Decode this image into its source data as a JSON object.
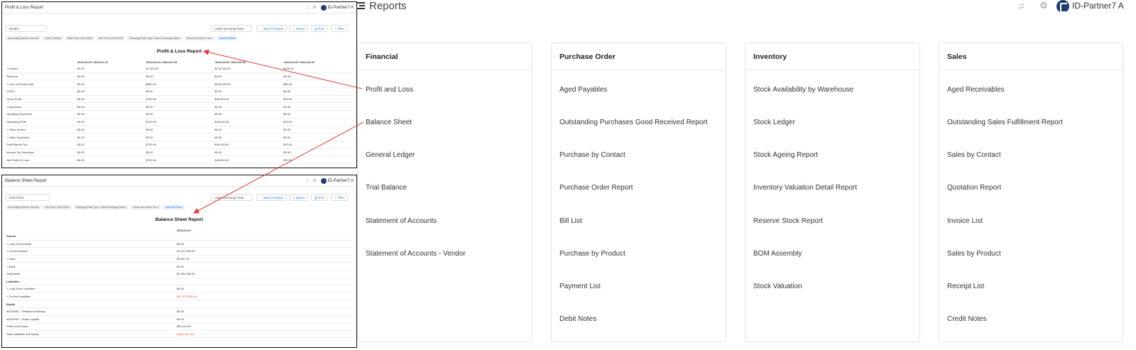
{
  "header": {
    "title": "Reports",
    "user": "ID-Partner7 A",
    "icons": [
      "hamburger-icon",
      "bell-icon",
      "gear-icon",
      "avatar"
    ]
  },
  "categories": [
    {
      "title": "Financial",
      "items": [
        "Profit and Loss",
        "Balance Sheet",
        "General Ledger",
        "Trial Balance",
        "Statement of Accounts",
        "Statement of Accounts - Vendor"
      ]
    },
    {
      "title": "Purchase Order",
      "items": [
        "Aged Payables",
        "Outstanding Purchases Good Received Report",
        "Purchase by Contact",
        "Purchase Order Report",
        "Bill List",
        "Purchase by Product",
        "Payment List",
        "Debit Notes"
      ]
    },
    {
      "title": "Inventory",
      "items": [
        "Stock Availability by Warehouse",
        "Stock Ledger",
        "Stock Ageing Report",
        "Inventory Valuation Detail Report",
        "Reserve Stock Report",
        "BOM Assembly",
        "Stock Valuation"
      ]
    },
    {
      "title": "Sales",
      "items": [
        "Aged Receivables",
        "Outstanding Sales Fulfillment Report",
        "Sales by Contact",
        "Quotation Report",
        "Invoice List",
        "Sales by Product",
        "Receipt List",
        "Credit Notes"
      ]
    }
  ],
  "pl": {
    "window_title": "Profit & Loss Report",
    "user": "ID-Partner7 A",
    "period_select": "Months",
    "rate_select": "Latest Exchange Rate",
    "buttons": {
      "back": "← Back to Report",
      "export": "⇩ Export",
      "print": "⎙ Print",
      "filter": "⊤ Filter"
    },
    "chips": [
      "Accounting Method: Accrual",
      "Cycle: Months",
      "Start Time: 01/01/2024",
      "End Time: 04/07/2024",
      "Exchange Rate Type: Latest Exchange Rate ×",
      "Show zero items: Yes ×"
    ],
    "clear": "Clear All Filters",
    "report_title": "Profit & Loss Report",
    "columns": [
      "2024-01-01~2024-01-31",
      "2024-02-01~2024-02-29",
      "2024-03-01~2024-03-31",
      "2024-04-01~2024-04-07"
    ],
    "rows": [
      {
        "label": "+ Income",
        "v": [
          "$0.00",
          "$1,300.00",
          "$176,000.00",
          "$150.00"
        ]
      },
      {
        "label": "Revenue",
        "v": [
          "$0.00",
          "$0.00",
          "$0.00",
          "$0.00"
        ]
      },
      {
        "label": "+ Cost of Goods Sold",
        "v": [
          "$0.00",
          "$600.00",
          "$130,000.00",
          "$80.00"
        ]
      },
      {
        "label": "COGS",
        "v": [
          "$0.00",
          "$0.00",
          "$0.00",
          "$0.00"
        ]
      },
      {
        "label": "Gross Profit",
        "v": [
          "$0.00",
          "$700.00",
          "$46,000.00",
          "$70.00"
        ]
      },
      {
        "label": "+ Expenses",
        "v": [
          "$0.00",
          "$0.00",
          "$0.00",
          "$0.00"
        ]
      },
      {
        "label": "Operating Expenses",
        "v": [
          "$0.00",
          "$0.00",
          "$0.00",
          "$0.00"
        ]
      },
      {
        "label": "Operating Profit",
        "v": [
          "$0.00",
          "$700.00",
          "$46,000.00",
          "$70.00"
        ]
      },
      {
        "label": "+ Other Income",
        "v": [
          "$0.00",
          "$0.00",
          "$0.00",
          "$0.00"
        ]
      },
      {
        "label": "+ Other Expenses",
        "v": [
          "$0.00",
          "$0.00",
          "$0.00",
          "$0.00"
        ]
      },
      {
        "label": "Profit Before Tax",
        "v": [
          "$0.00",
          "$700.00",
          "$46,000.00",
          "$70.00"
        ]
      },
      {
        "label": "Income Tax Expenses",
        "v": [
          "$0.00",
          "$0.00",
          "$0.00",
          "$0.00"
        ]
      },
      {
        "label": "Net Profit Or Loss",
        "v": [
          "$0.00",
          "$700.00",
          "$46,000.00",
          "$70.00"
        ]
      }
    ]
  },
  "bs": {
    "window_title": "Balance Sheet Report",
    "user": "ID-Partner7 A",
    "date": "04/07/2024",
    "rate_select": "Latest Exchange Rate",
    "buttons": {
      "back": "← Back to Report",
      "export": "⇩ Export",
      "print": "⎙ Print",
      "filter": "⊤ Filter"
    },
    "chips": [
      "Accounting Method: Accrual",
      "End Time: 04/07/2024",
      "Exchange Rate Type: Latest Exchange Rate ×",
      "Show zero items: Yes ×"
    ],
    "clear": "Clear All Filters",
    "report_title": "Balance Sheet Report",
    "column": "2024-04-07",
    "rows": [
      {
        "label": "Assets",
        "v": "",
        "sec": true
      },
      {
        "label": "+ Long Term Assets",
        "v": "$0.00"
      },
      {
        "label": "+ Current Assets",
        "v": "$1,247,909.00"
      },
      {
        "label": "+ Cash",
        "v": "$3,997.00"
      },
      {
        "label": "+ Bank",
        "v": "$0.00"
      },
      {
        "label": "Total Asset",
        "v": "$1,251,906.00"
      },
      {
        "label": "Liabilities",
        "v": "",
        "sec": true
      },
      {
        "label": "+ Long Term Liabilities",
        "v": "$0.00"
      },
      {
        "label": "+ Current Liabilities",
        "v": "($1,217,618.00)",
        "neg": true
      },
      {
        "label": "Equity",
        "v": "",
        "sec": true
      },
      {
        "label": "A0100002 - Retained Earnings",
        "v": "$0.00"
      },
      {
        "label": "A0100001 - Share Capital",
        "v": "$0.00"
      },
      {
        "label": "Profit for the year",
        "v": "$53,114.90"
      },
      {
        "label": "Total Liabilities and equity",
        "v": "($964,801.00)",
        "neg": true
      }
    ]
  },
  "colors": {
    "arrow": "#e53935",
    "link": "#2a7ae2",
    "negative": "#e74c3c",
    "avatar": "#1f3f73"
  }
}
